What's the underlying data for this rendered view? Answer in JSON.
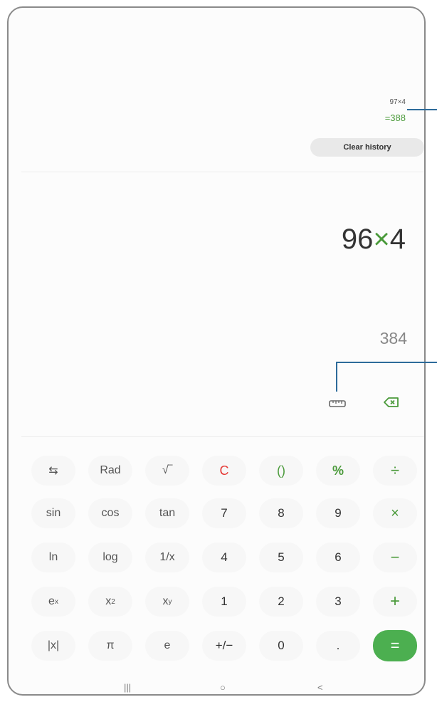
{
  "history": {
    "expression": "97×4",
    "result": "=388",
    "clear_label": "Clear history"
  },
  "display": {
    "expr_left": "96",
    "expr_op": "×",
    "expr_right": "4",
    "preview": "384"
  },
  "tools": {
    "unit_converter_icon": "ruler-icon",
    "backspace_icon": "backspace-icon"
  },
  "keys": {
    "row1": [
      "⇆",
      "Rad",
      "√‾",
      "C",
      "()",
      "%",
      "÷"
    ],
    "row2": [
      "sin",
      "cos",
      "tan",
      "7",
      "8",
      "9",
      "×"
    ],
    "row3": [
      "ln",
      "log",
      "1/x",
      "4",
      "5",
      "6",
      "−"
    ],
    "row4_ex_base": "e",
    "row4_ex_sup": "x",
    "row4_x2_base": "x",
    "row4_x2_sup": "2",
    "row4_xy_base": "x",
    "row4_xy_sup": "y",
    "row4": [
      "1",
      "2",
      "3",
      "+"
    ],
    "row5": [
      "|x|",
      "π",
      "e",
      "+/−",
      "0",
      ".",
      "="
    ]
  },
  "nav": {
    "recents": "|||",
    "home": "○",
    "back": "<"
  },
  "colors": {
    "accent_green": "#4a9a3a",
    "equals_bg": "#4caf50",
    "clear_red": "#e53935",
    "callout_blue": "#2d6b9a"
  }
}
